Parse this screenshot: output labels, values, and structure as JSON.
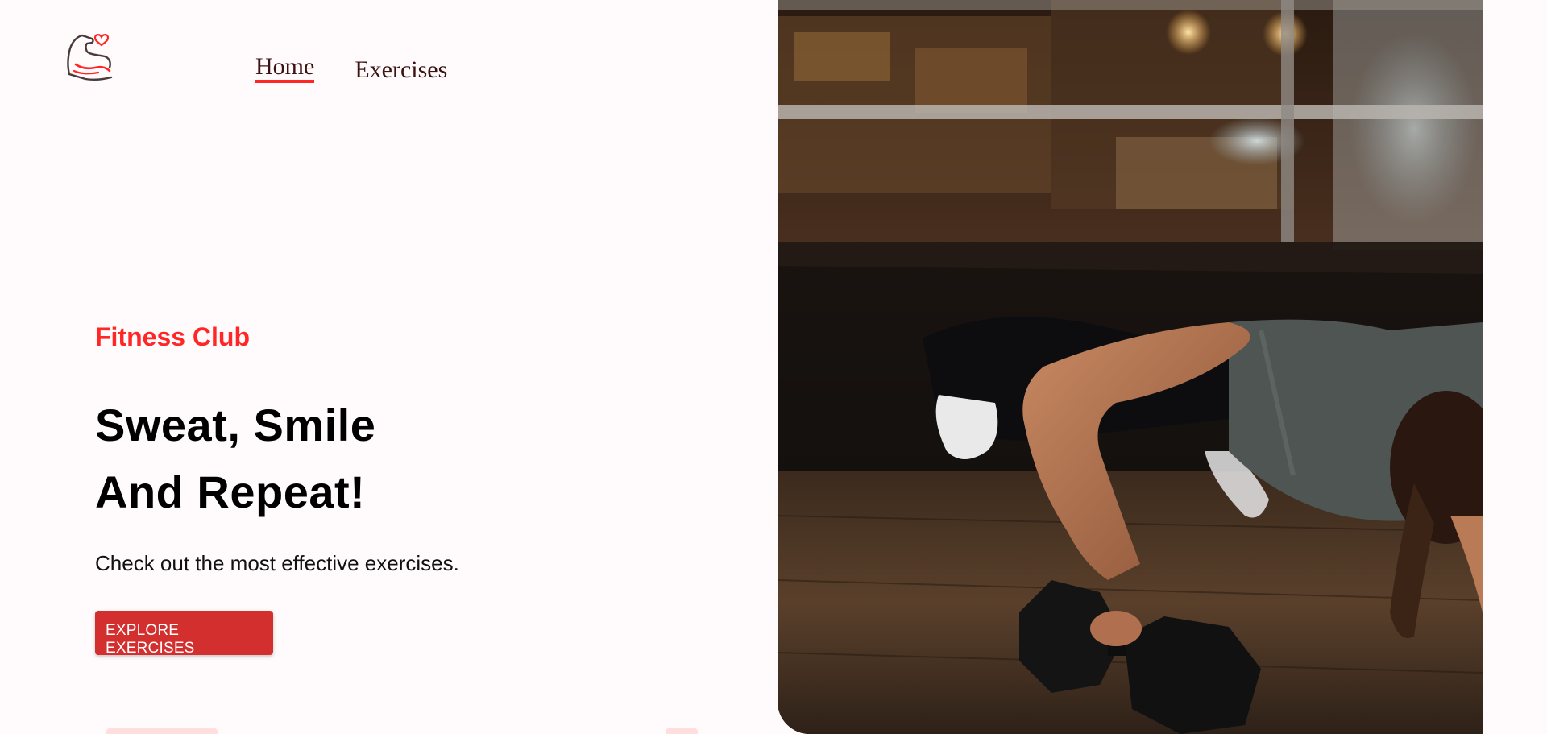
{
  "header": {
    "logo_alt": "flexed arm with heart logo",
    "nav": [
      {
        "label": "Home",
        "active": true
      },
      {
        "label": "Exercises",
        "active": false
      }
    ]
  },
  "hero": {
    "eyebrow": "Fitness Club",
    "title_line1": "Sweat, Smile",
    "title_line2": "And Repeat!",
    "subtitle": "Check out the most effective exercises.",
    "cta_label": "EXPLORE EXERCISES"
  },
  "banner": {
    "image_description_icon": "photo-icon"
  },
  "colors": {
    "accent": "#ff2625",
    "button": "#d32f2f",
    "background": "#fffafb",
    "nav_text": "#3a1212"
  }
}
